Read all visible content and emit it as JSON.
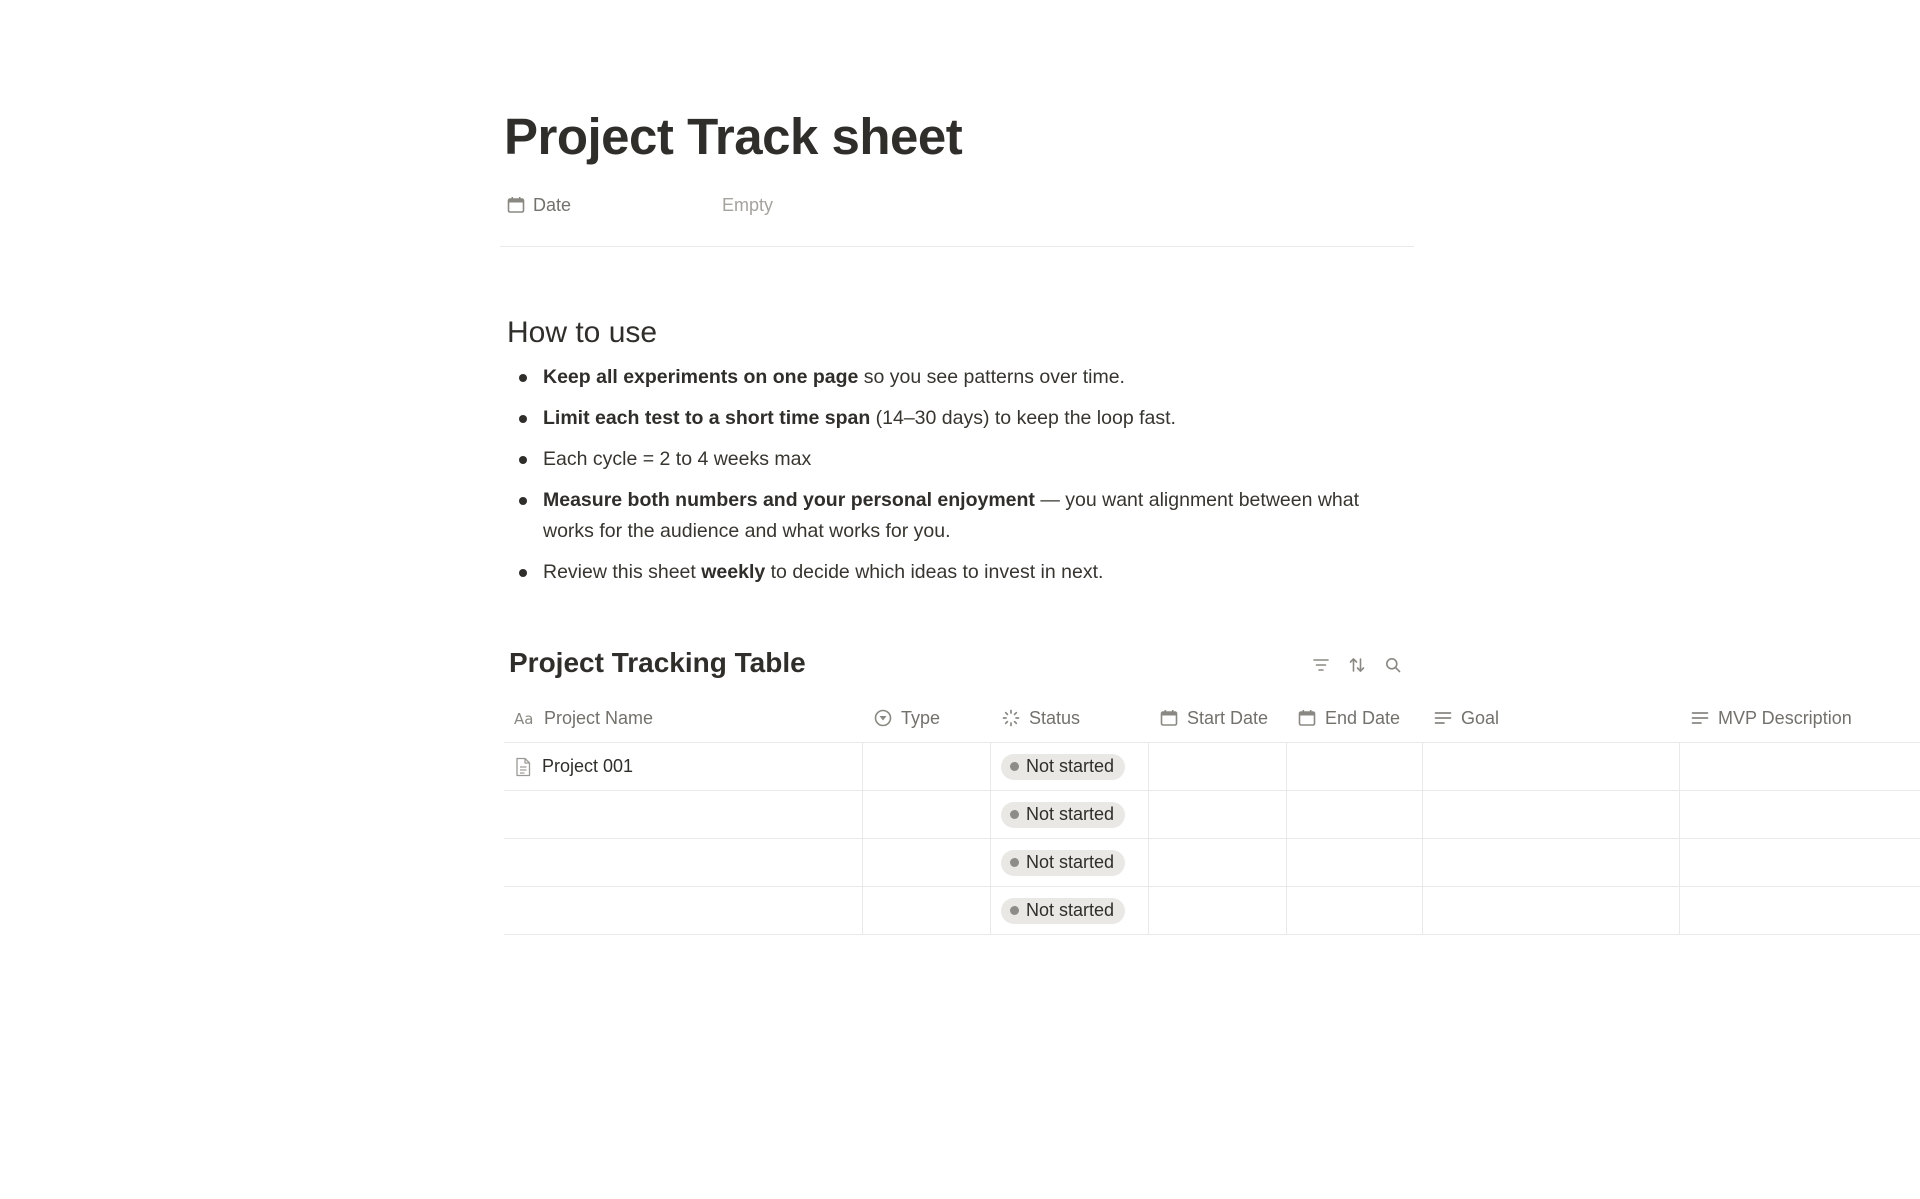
{
  "page": {
    "title": "Project Track sheet"
  },
  "properties": [
    {
      "name": "Date",
      "icon": "calendar-icon",
      "value": "Empty"
    }
  ],
  "how_to_use": {
    "heading": "How to use",
    "bullets": [
      {
        "bold": "Keep all experiments on one page",
        "rest": " so you see patterns over time."
      },
      {
        "bold": "Limit each test to a short time span",
        "rest": " (14–30 days) to keep the loop fast."
      },
      {
        "pre": "Each cycle = 2 to 4 weeks max"
      },
      {
        "bold": "Measure both numbers and your personal enjoyment",
        "rest": " — you want alignment between what works for the audience and what works for you."
      },
      {
        "pre": "Review this sheet ",
        "bold": "weekly",
        "rest": " to decide which ideas to invest in next."
      }
    ]
  },
  "database": {
    "title": "Project Tracking Table",
    "toolbar": [
      {
        "name": "filter-icon"
      },
      {
        "name": "sort-icon"
      },
      {
        "name": "search-icon"
      }
    ],
    "columns": [
      {
        "label": "Project Name",
        "icon": "title-icon"
      },
      {
        "label": "Type",
        "icon": "select-icon"
      },
      {
        "label": "Status",
        "icon": "status-icon"
      },
      {
        "label": "Start Date",
        "icon": "calendar-icon"
      },
      {
        "label": "End Date",
        "icon": "calendar-icon"
      },
      {
        "label": "Goal",
        "icon": "text-icon"
      },
      {
        "label": "MVP Description",
        "icon": "text-icon"
      }
    ],
    "rows": [
      {
        "name": "Project 001",
        "type": "",
        "status": "Not started",
        "start": "",
        "end": "",
        "goal": "",
        "mvp": ""
      },
      {
        "name": "",
        "type": "",
        "status": "Not started",
        "start": "",
        "end": "",
        "goal": "",
        "mvp": ""
      },
      {
        "name": "",
        "type": "",
        "status": "Not started",
        "start": "",
        "end": "",
        "goal": "",
        "mvp": ""
      },
      {
        "name": "",
        "type": "",
        "status": "Not started",
        "start": "",
        "end": "",
        "goal": "",
        "mvp": ""
      }
    ]
  },
  "colors": {
    "text": "#37352f",
    "muted": "#73716c",
    "placeholder": "#a5a39e",
    "border": "#e9e9e7",
    "status_badge_bg": "#e9e8e5",
    "status_dot": "#8e8c87"
  }
}
